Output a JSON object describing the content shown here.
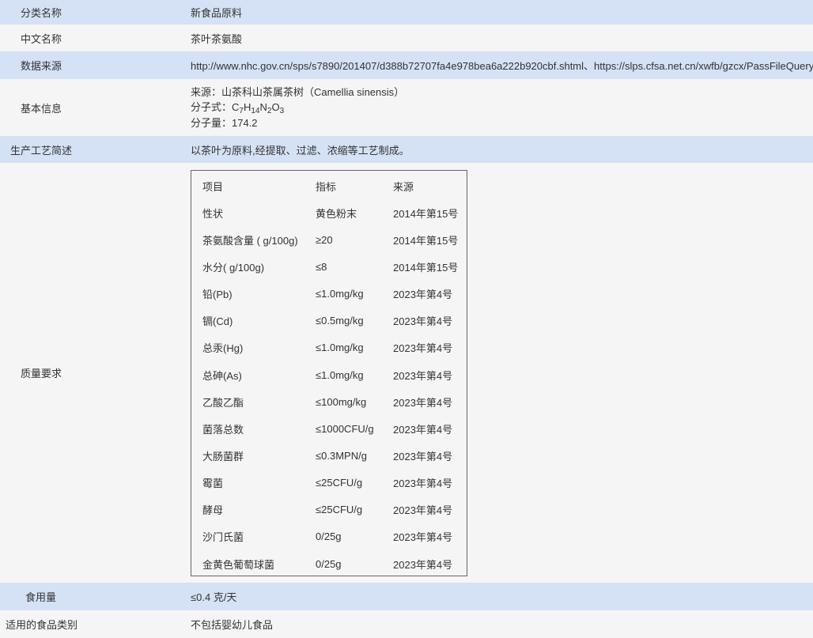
{
  "rows": {
    "category": {
      "label": "分类名称",
      "value": "新食品原料"
    },
    "chinese_name": {
      "label": "中文名称",
      "value": "茶叶茶氨酸"
    },
    "data_source": {
      "label": "数据来源",
      "value": "http://www.nhc.gov.cn/sps/s7890/201407/d388b72707fa4e978bea6a222b920cbf.shtml、https://slps.cfsa.net.cn/xwfb/gzcx/PassFileQuery.jsp"
    },
    "basic_info": {
      "label": "基本信息",
      "source_line": "来源：山茶科山茶属茶树（Camellia sinensis）",
      "formula_prefix": "分子式：",
      "formula": {
        "c": "C",
        "c_n": "7",
        "h": "H",
        "h_n": "14",
        "n": "N",
        "n_n": "2",
        "o": "O",
        "o_n": "3"
      },
      "weight_line": "分子量：174.2"
    },
    "process": {
      "label": "生产工艺简述",
      "value": "以茶叶为原料,经提取、过滤、浓缩等工艺制成。"
    },
    "quality": {
      "label": "质量要求"
    },
    "intake": {
      "label": "食用量",
      "value": "≤0.4 克/天"
    },
    "applicable": {
      "label": "适用的食品类别",
      "value": "不包括婴幼儿食品"
    }
  },
  "quality_table": {
    "headers": [
      "项目",
      "指标",
      "来源"
    ],
    "rows": [
      [
        "性状",
        "黄色粉末",
        "2014年第15号"
      ],
      [
        "茶氨酸含量 ( g/100g)",
        "≥20",
        "2014年第15号"
      ],
      [
        "水分( g/100g)",
        "≤8",
        "2014年第15号"
      ],
      [
        "铅(Pb)",
        "≤1.0mg/kg",
        "2023年第4号"
      ],
      [
        "镉(Cd)",
        "≤0.5mg/kg",
        "2023年第4号"
      ],
      [
        "总汞(Hg)",
        "≤1.0mg/kg",
        "2023年第4号"
      ],
      [
        "总砷(As)",
        "≤1.0mg/kg",
        "2023年第4号"
      ],
      [
        "乙酸乙酯",
        "≤100mg/kg",
        "2023年第4号"
      ],
      [
        "菌落总数",
        "≤1000CFU/g",
        "2023年第4号"
      ],
      [
        "大肠菌群",
        "≤0.3MPN/g",
        "2023年第4号"
      ],
      [
        "霉菌",
        "≤25CFU/g",
        "2023年第4号"
      ],
      [
        "酵母",
        "≤25CFU/g",
        "2023年第4号"
      ],
      [
        "沙门氏菌",
        "0/25g",
        "2023年第4号"
      ],
      [
        "金黄色葡萄球菌",
        "0/25g",
        "2023年第4号"
      ]
    ]
  }
}
